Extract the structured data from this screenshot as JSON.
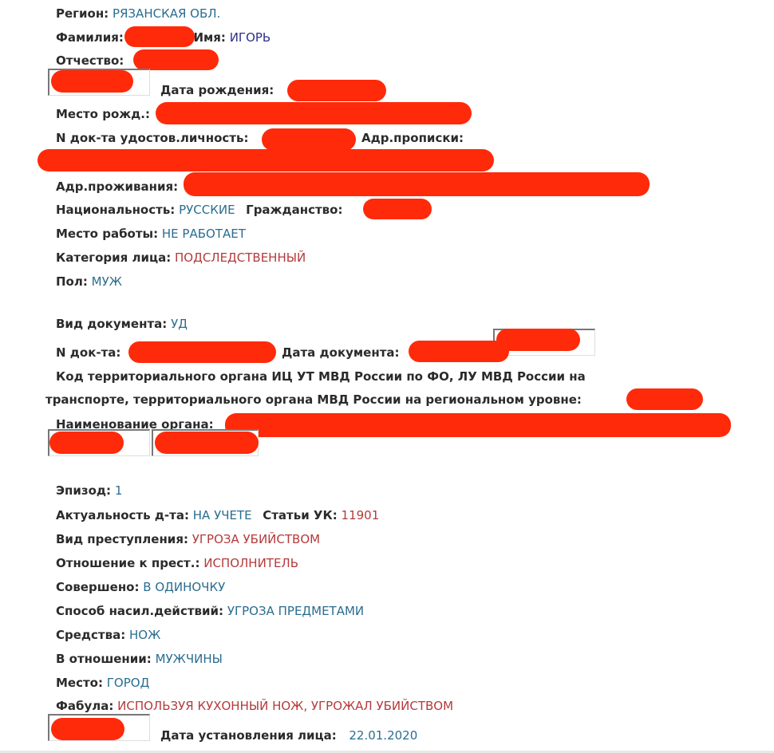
{
  "person": {
    "region_label": "Регион:",
    "region_value": "РЯЗАНСКАЯ ОБЛ.",
    "surname_label": "Фамилия:",
    "name_label": "Имя:",
    "name_value": "ИГОРЬ",
    "patronymic_label": "Отчество:",
    "birthdate_label": "Дата рождения:",
    "birthplace_label": "Место рожд.:",
    "id_doc_label": "N док-та удостов.личность:",
    "reg_address_label": "Адр.прописки:",
    "live_address_label": "Адр.проживания:",
    "nationality_label": "Национальность:",
    "nationality_value": "РУССКИЕ",
    "citizenship_label": "Гражданство:",
    "workplace_label": "Место работы:",
    "workplace_value": "НЕ РАБОТАЕТ",
    "category_label": "Категория лица:",
    "category_value": "ПОДСЛЕДСТВЕННЫЙ",
    "sex_label": "Пол:",
    "sex_value": "МУЖ"
  },
  "document": {
    "type_label": "Вид документа:",
    "type_value": "УД",
    "number_label": "N док-та:",
    "date_label": "Дата документа:",
    "code_label_line1": "Код территориального органа ИЦ УТ МВД России по ФО, ЛУ МВД России на",
    "code_label_line2": "транспорте, территориального органа МВД России на региональном уровне:",
    "org_name_label": "Наименование органа:"
  },
  "episode": {
    "episode_label": "Эпизод:",
    "episode_value": "1",
    "actuality_label": "Актуальность д-та:",
    "actuality_value": "НА УЧЕТЕ",
    "article_label": "Статьи УК:",
    "article_value": "11901",
    "crime_type_label": "Вид преступления:",
    "crime_type_value": "УГРОЗА УБИЙСТВОМ",
    "relation_label": "Отношение к прест.:",
    "relation_value": "ИСПОЛНИТЕЛЬ",
    "committed_label": "Совершено:",
    "committed_value": "В ОДИНОЧКУ",
    "violence_method_label": "Способ насил.действий:",
    "violence_method_value": "УГРОЗА ПРЕДМЕТАМИ",
    "means_label": "Средства:",
    "means_value": "НОЖ",
    "victim_label": "В отношении:",
    "victim_value": "МУЖЧИНЫ",
    "place_label": "Место:",
    "place_value": "ГОРОД",
    "plot_label": "Фабула:",
    "plot_value": "ИСПОЛЬЗУЯ КУХОННЫЙ НОЖ, УГРОЖАЛ УБИЙСТВОМ",
    "identified_date_label": "Дата установления лица:",
    "identified_date_value": "22.01.2020"
  },
  "colors": {
    "label": "#2b2b2b",
    "value_blue": "#2a6d8f",
    "value_red": "#b53a3a",
    "redaction": "#ff2a0a"
  }
}
